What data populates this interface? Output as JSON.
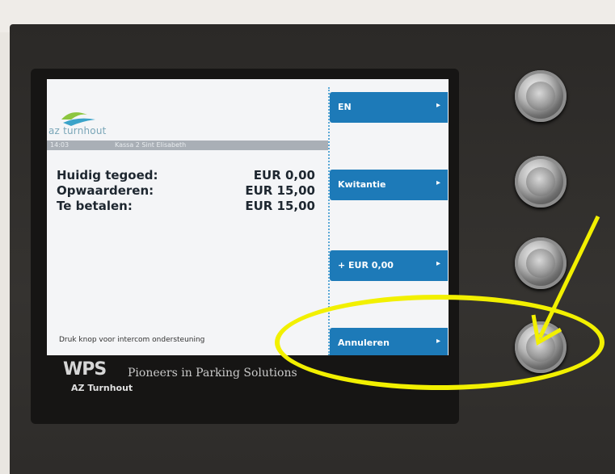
{
  "screen": {
    "logo_text": "az turnhout",
    "info_time": "14:03",
    "info_location": "Kassa 2 Sint Elisabeth",
    "rows": [
      {
        "label": "Huidig tegoed:",
        "value": "EUR 0,00"
      },
      {
        "label": "Opwaarderen:",
        "value": "EUR 15,00"
      },
      {
        "label": "Te betalen:",
        "value": "EUR 15,00"
      }
    ],
    "hint": "Druk  knop voor intercom ondersteuning"
  },
  "side_buttons": [
    {
      "label": "EN",
      "arrow": "▸"
    },
    {
      "label": "Kwitantie",
      "arrow": "▸"
    },
    {
      "label": "+ EUR 0,00",
      "arrow": "▸"
    },
    {
      "label": "Annuleren",
      "arrow": "▸"
    }
  ],
  "branding": {
    "logo": "WPS",
    "tagline": "Pioneers in Parking Solutions",
    "site": "AZ Turnhout"
  },
  "colors": {
    "button_blue": "#1d7ab8",
    "annotation_yellow": "#f2f000"
  }
}
